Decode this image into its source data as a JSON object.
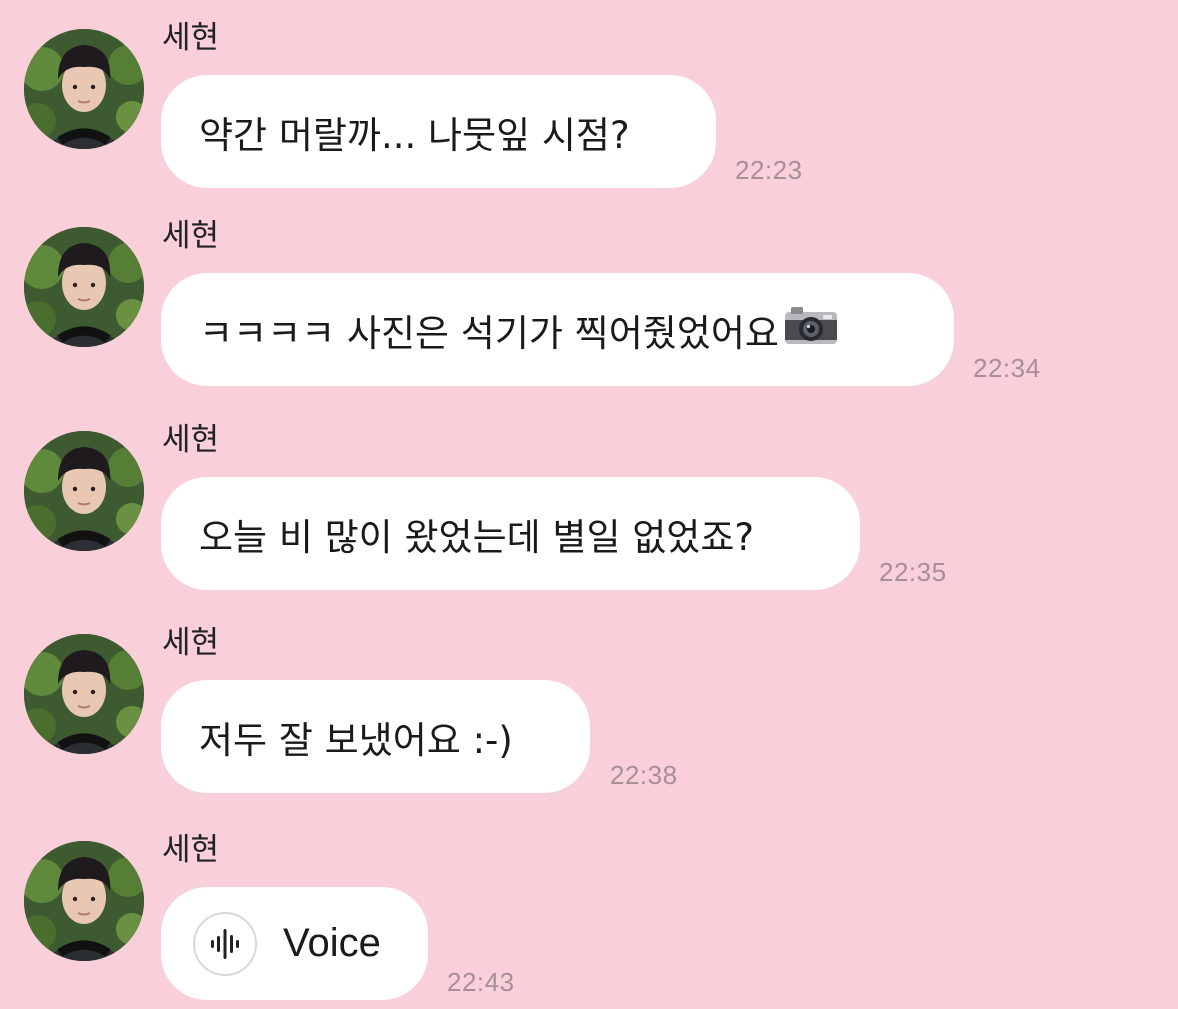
{
  "messages": [
    {
      "sender": "세현",
      "text": "약간 머랄까... 나뭇잎 시점?",
      "time": "22:23"
    },
    {
      "sender": "세현",
      "text": "ㅋㅋㅋㅋ 사진은 석기가 찍어줬었어요",
      "time": "22:34",
      "icon": "camera-icon"
    },
    {
      "sender": "세현",
      "text": "오늘 비 많이 왔었는데 별일 없었죠?",
      "time": "22:35"
    },
    {
      "sender": "세현",
      "text": "저두 잘 보냈어요 :-)",
      "time": "22:38"
    },
    {
      "sender": "세현",
      "text": "Voice",
      "time": "22:43",
      "icon": "voice-waveform-icon"
    }
  ]
}
